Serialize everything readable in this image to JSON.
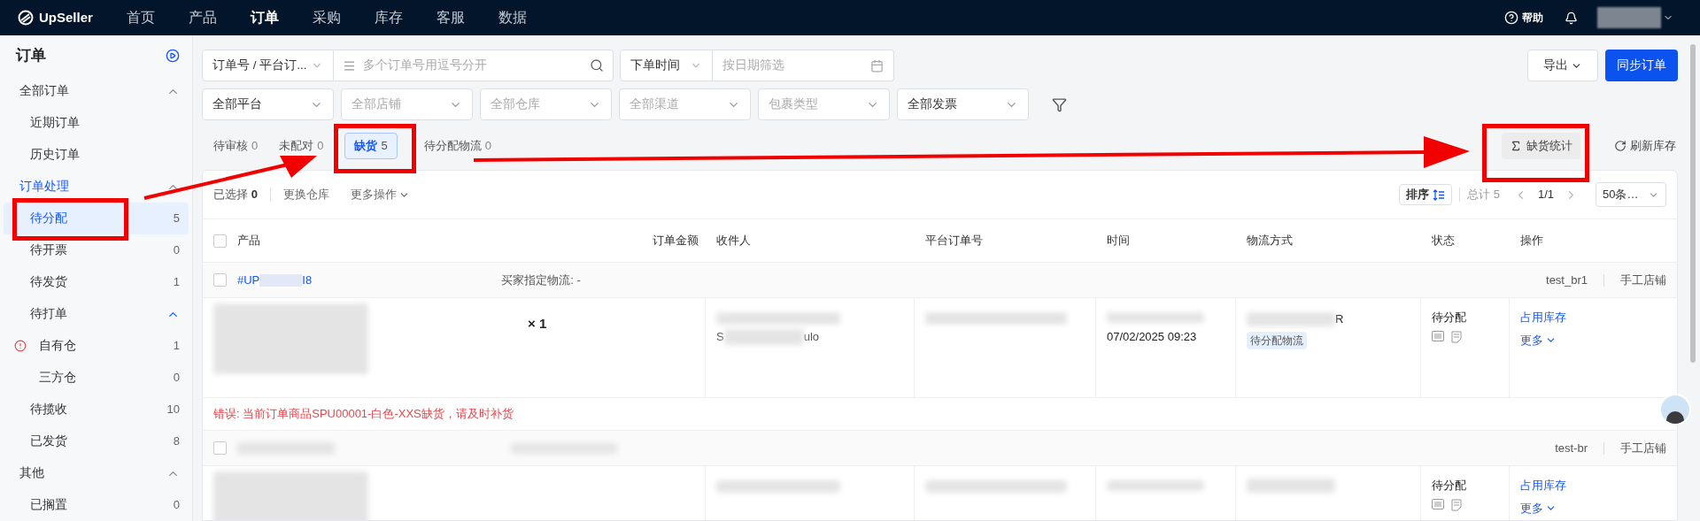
{
  "topbar": {
    "logo": "UpSeller",
    "nav": [
      {
        "label": "首页",
        "selected": false
      },
      {
        "label": "产品",
        "selected": false
      },
      {
        "label": "订单",
        "selected": true
      },
      {
        "label": "采购",
        "selected": false
      },
      {
        "label": "库存",
        "selected": false
      },
      {
        "label": "客服",
        "selected": false
      },
      {
        "label": "数据",
        "selected": false
      }
    ],
    "help": "帮助"
  },
  "sidebar": {
    "title": "订单",
    "groups": [
      {
        "label": "全部订单",
        "selected": false,
        "expanded": true,
        "children": [
          {
            "label": "近期订单",
            "selected": false
          },
          {
            "label": "历史订单",
            "selected": false
          }
        ]
      },
      {
        "label": "订单处理",
        "selected": true,
        "expanded": true,
        "children": [
          {
            "label": "待分配",
            "count": "5",
            "selected": true
          },
          {
            "label": "待开票",
            "count": "0",
            "selected": false
          },
          {
            "label": "待发货",
            "count": "1",
            "selected": false
          },
          {
            "label": "待打单",
            "selected": false,
            "expanded": true,
            "children": [
              {
                "label": "自有仓",
                "count": "1",
                "selected": false,
                "warning": true
              },
              {
                "label": "三方仓",
                "count": "0",
                "selected": false,
                "warning": false
              }
            ]
          },
          {
            "label": "待揽收",
            "count": "10",
            "selected": false
          },
          {
            "label": "已发货",
            "count": "8",
            "selected": false
          }
        ]
      },
      {
        "label": "其他",
        "selected": false,
        "expanded": true,
        "children": [
          {
            "label": "已搁置",
            "count": "0",
            "selected": false
          }
        ]
      }
    ]
  },
  "filters": {
    "search_type": "订单号 / 平台订...",
    "search_placeholder": "多个订单号用逗号分开",
    "time_type": "下单时间",
    "date_placeholder": "按日期筛选",
    "selects": [
      {
        "value": "全部平台"
      },
      {
        "placeholder": "全部店铺"
      },
      {
        "placeholder": "全部仓库"
      },
      {
        "placeholder": "全部渠道"
      },
      {
        "placeholder": "包裹类型"
      },
      {
        "value": "全部发票"
      }
    ],
    "export": "导出",
    "sync": "同步订单"
  },
  "status_tabs": [
    {
      "label": "待审核",
      "count": "0",
      "selected": false
    },
    {
      "label": "未配对",
      "count": "0",
      "selected": false
    },
    {
      "label": "缺货",
      "count": "5",
      "selected": true
    },
    {
      "label": "待分配物流",
      "count": "0",
      "selected": false
    }
  ],
  "tools": {
    "stats": "缺货统计",
    "refresh": "刷新库存"
  },
  "toolbar": {
    "selected_label": "已选择",
    "selected_count": "0",
    "actions": [
      "更换仓库",
      "更多操作"
    ],
    "sort": "排序",
    "total": "总计 5",
    "page": "1/1",
    "page_size": "50条…"
  },
  "table": {
    "all_checked": false,
    "columns": [
      "产品",
      "订单金额",
      "收件人",
      "平台订单号",
      "时间",
      "物流方式",
      "状态",
      "操作"
    ],
    "orders": [
      {
        "checked": false,
        "order_no": "#UP",
        "order_no_end": "I8",
        "buyer_logistics": "买家指定物流: -",
        "shop": "test_br1",
        "shop_type": "手工店铺",
        "quantity": "× 1",
        "recipient_initial": "S",
        "recipient_fragment": "ulo",
        "time": "07/02/2025 09:23",
        "logistics_fragment": "R",
        "logistics_tag": "待分配物流",
        "status": "待分配",
        "actions": [
          "占用库存",
          "更多"
        ],
        "error": "错误: 当前订单商品SPU00001-白色-XXS缺货，请及时补货"
      },
      {
        "checked": false,
        "shop": "test-br",
        "shop_type": "手工店铺",
        "status": "待分配",
        "actions": [
          "占用库存",
          "更多"
        ]
      }
    ]
  }
}
